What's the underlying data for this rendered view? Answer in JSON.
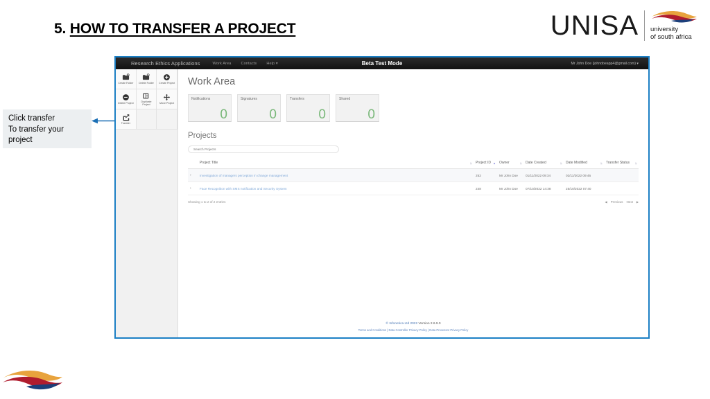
{
  "slide": {
    "title_number": "5.",
    "title_text": "HOW TO TRANSFER A PROJECT"
  },
  "logo": {
    "wordmark": "UNISA",
    "sub_line1": "university",
    "sub_line2": "of south africa"
  },
  "callout": {
    "line1": "Click transfer",
    "line2": "To transfer your",
    "line3": "project"
  },
  "app": {
    "navbar": {
      "brand": "Research Ethics Applications",
      "links": [
        {
          "label": "Work Area"
        },
        {
          "label": "Contacts"
        },
        {
          "label": "Help ▾"
        }
      ],
      "beta_banner": "Beta Test Mode",
      "user": "Mr John Doe (johndoeapp4@gmail.com) ▾"
    },
    "toolbar": {
      "items": [
        {
          "label": "Create Folder",
          "icon": "create-folder-icon"
        },
        {
          "label": "Delete Folder",
          "icon": "delete-folder-icon"
        },
        {
          "label": "Create Project",
          "icon": "create-project-icon"
        },
        {
          "label": "Delete Project",
          "icon": "delete-project-icon"
        },
        {
          "label": "Duplicate Project",
          "icon": "duplicate-project-icon"
        },
        {
          "label": "Move Project",
          "icon": "move-project-icon"
        },
        {
          "label": "Transfer",
          "icon": "transfer-icon"
        }
      ]
    },
    "page_title": "Work Area",
    "cards": [
      {
        "label": "Notifications",
        "value": "0"
      },
      {
        "label": "Signatures",
        "value": "0"
      },
      {
        "label": "Transfers",
        "value": "0"
      },
      {
        "label": "Shared",
        "value": "0"
      }
    ],
    "projects": {
      "heading": "Projects",
      "search_placeholder": "Search Projects",
      "columns": [
        {
          "label": "Project Title"
        },
        {
          "label": "Project ID"
        },
        {
          "label": "Owner"
        },
        {
          "label": "Date Created"
        },
        {
          "label": "Date Modified"
        },
        {
          "label": "Transfer Status"
        }
      ],
      "rows": [
        {
          "title": "Investigation of managers perception in change management",
          "id": "252",
          "owner": "Mr John Doe",
          "date_created": "01/11/2022 09:34",
          "date_modified": "02/11/2022 09:46",
          "transfer_status": ""
        },
        {
          "title": "Face Recognition with SMS notification and Security System",
          "id": "248",
          "owner": "Mr John Doe",
          "date_created": "07/10/2022 14:38",
          "date_modified": "25/10/2022 07:40",
          "transfer_status": ""
        }
      ],
      "entries_text": "Showing 1 to 2 of 2 entries",
      "pager": {
        "previous": "Previous",
        "next": "Next"
      }
    },
    "footer": {
      "copyright": "© Infonetica Ltd 2022",
      "version": "Version 2.6.9.0",
      "links": "Terms and Conditions | Data Controller Privacy Policy | Data Processor Privacy Policy"
    }
  },
  "colors": {
    "frame_blue": "#1b7fc4",
    "navbar_dark": "#1c1c1c",
    "stat_green": "#7ab87a",
    "link_blue": "#7fa8d8",
    "callout_bg": "#eceff1"
  }
}
